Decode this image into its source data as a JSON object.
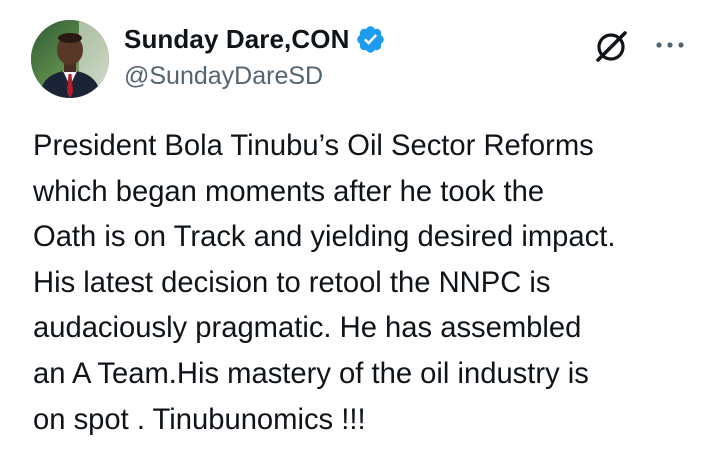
{
  "author": {
    "display_name": "Sunday Dare,CON",
    "handle": "@SundayDareSD",
    "verified_color": "#1d9bf0"
  },
  "icons": {
    "avatar": "profile-photo",
    "verified": "verified-badge-icon",
    "grok": "grok-icon",
    "more": "more-options-icon"
  },
  "tweet": {
    "lines": [
      "President Bola Tinubu’s Oil Sector Reforms",
      "which began moments after he took the",
      "Oath is on Track and yielding desired impact.",
      "His latest decision to retool the NNPC is",
      "audaciously pragmatic. He has assembled",
      "an A Team.His mastery of the oil industry is",
      "on spot . Tinubunomics !!!"
    ]
  }
}
